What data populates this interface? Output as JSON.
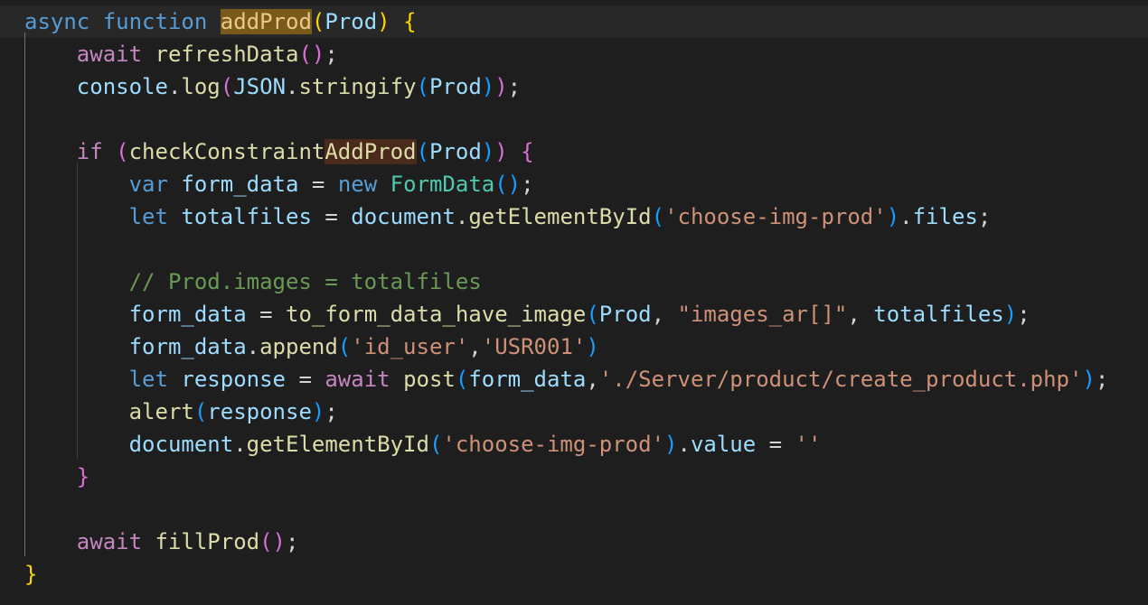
{
  "editor": {
    "lines": [
      [
        {
          "t": "async",
          "c": "kw"
        },
        {
          "t": " ",
          "c": "p"
        },
        {
          "t": "function",
          "c": "kw"
        },
        {
          "t": " ",
          "c": "p"
        },
        {
          "t": "addProd",
          "c": "fn",
          "hl": "sel"
        },
        {
          "t": "(",
          "c": "b1"
        },
        {
          "t": "Prod",
          "c": "var"
        },
        {
          "t": ")",
          "c": "b1"
        },
        {
          "t": " ",
          "c": "p"
        },
        {
          "t": "{",
          "c": "b1"
        }
      ],
      [
        {
          "t": "    ",
          "c": "p"
        },
        {
          "t": "await",
          "c": "ctl"
        },
        {
          "t": " ",
          "c": "p"
        },
        {
          "t": "refreshData",
          "c": "fn"
        },
        {
          "t": "(",
          "c": "b2"
        },
        {
          "t": ")",
          "c": "b2"
        },
        {
          "t": ";",
          "c": "p"
        }
      ],
      [
        {
          "t": "    ",
          "c": "p"
        },
        {
          "t": "console",
          "c": "var"
        },
        {
          "t": ".",
          "c": "p"
        },
        {
          "t": "log",
          "c": "fn"
        },
        {
          "t": "(",
          "c": "b2"
        },
        {
          "t": "JSON",
          "c": "var"
        },
        {
          "t": ".",
          "c": "p"
        },
        {
          "t": "stringify",
          "c": "fn"
        },
        {
          "t": "(",
          "c": "b3"
        },
        {
          "t": "Prod",
          "c": "var"
        },
        {
          "t": ")",
          "c": "b3"
        },
        {
          "t": ")",
          "c": "b2"
        },
        {
          "t": ";",
          "c": "p"
        }
      ],
      [],
      [
        {
          "t": "    ",
          "c": "p"
        },
        {
          "t": "if",
          "c": "ctl"
        },
        {
          "t": " ",
          "c": "p"
        },
        {
          "t": "(",
          "c": "b2"
        },
        {
          "t": "checkConstraint",
          "c": "fn"
        },
        {
          "t": "AddProd",
          "c": "fn",
          "hl": "match"
        },
        {
          "t": "(",
          "c": "b3"
        },
        {
          "t": "Prod",
          "c": "var"
        },
        {
          "t": ")",
          "c": "b3"
        },
        {
          "t": ")",
          "c": "b2"
        },
        {
          "t": " ",
          "c": "p"
        },
        {
          "t": "{",
          "c": "b2"
        }
      ],
      [
        {
          "t": "        ",
          "c": "p"
        },
        {
          "t": "var",
          "c": "kw"
        },
        {
          "t": " ",
          "c": "p"
        },
        {
          "t": "form_data",
          "c": "var"
        },
        {
          "t": " = ",
          "c": "p"
        },
        {
          "t": "new",
          "c": "kw"
        },
        {
          "t": " ",
          "c": "p"
        },
        {
          "t": "FormData",
          "c": "cls"
        },
        {
          "t": "(",
          "c": "b3"
        },
        {
          "t": ")",
          "c": "b3"
        },
        {
          "t": ";",
          "c": "p"
        }
      ],
      [
        {
          "t": "        ",
          "c": "p"
        },
        {
          "t": "let",
          "c": "kw"
        },
        {
          "t": " ",
          "c": "p"
        },
        {
          "t": "totalfiles",
          "c": "var"
        },
        {
          "t": " = ",
          "c": "p"
        },
        {
          "t": "document",
          "c": "var"
        },
        {
          "t": ".",
          "c": "p"
        },
        {
          "t": "getElementById",
          "c": "fn"
        },
        {
          "t": "(",
          "c": "b3"
        },
        {
          "t": "'choose-img-prod'",
          "c": "str"
        },
        {
          "t": ")",
          "c": "b3"
        },
        {
          "t": ".",
          "c": "p"
        },
        {
          "t": "files",
          "c": "var"
        },
        {
          "t": ";",
          "c": "p"
        }
      ],
      [],
      [
        {
          "t": "        ",
          "c": "p"
        },
        {
          "t": "// Prod.images = totalfiles",
          "c": "cmt"
        }
      ],
      [
        {
          "t": "        ",
          "c": "p"
        },
        {
          "t": "form_data",
          "c": "var"
        },
        {
          "t": " = ",
          "c": "p"
        },
        {
          "t": "to_form_data_have_image",
          "c": "fn"
        },
        {
          "t": "(",
          "c": "b3"
        },
        {
          "t": "Prod",
          "c": "var"
        },
        {
          "t": ", ",
          "c": "p"
        },
        {
          "t": "\"images_ar[]\"",
          "c": "str"
        },
        {
          "t": ", ",
          "c": "p"
        },
        {
          "t": "totalfiles",
          "c": "var"
        },
        {
          "t": ")",
          "c": "b3"
        },
        {
          "t": ";",
          "c": "p"
        }
      ],
      [
        {
          "t": "        ",
          "c": "p"
        },
        {
          "t": "form_data",
          "c": "var"
        },
        {
          "t": ".",
          "c": "p"
        },
        {
          "t": "append",
          "c": "fn"
        },
        {
          "t": "(",
          "c": "b3"
        },
        {
          "t": "'id_user'",
          "c": "str"
        },
        {
          "t": ",",
          "c": "p"
        },
        {
          "t": "'USR001'",
          "c": "str"
        },
        {
          "t": ")",
          "c": "b3"
        }
      ],
      [
        {
          "t": "        ",
          "c": "p"
        },
        {
          "t": "let",
          "c": "kw"
        },
        {
          "t": " ",
          "c": "p"
        },
        {
          "t": "response",
          "c": "var"
        },
        {
          "t": " = ",
          "c": "p"
        },
        {
          "t": "await",
          "c": "ctl"
        },
        {
          "t": " ",
          "c": "p"
        },
        {
          "t": "post",
          "c": "fn"
        },
        {
          "t": "(",
          "c": "b3"
        },
        {
          "t": "form_data",
          "c": "var"
        },
        {
          "t": ",",
          "c": "p"
        },
        {
          "t": "'./Server/product/create_product.php'",
          "c": "str"
        },
        {
          "t": ")",
          "c": "b3"
        },
        {
          "t": ";",
          "c": "p"
        }
      ],
      [
        {
          "t": "        ",
          "c": "p"
        },
        {
          "t": "alert",
          "c": "fn"
        },
        {
          "t": "(",
          "c": "b3"
        },
        {
          "t": "response",
          "c": "var"
        },
        {
          "t": ")",
          "c": "b3"
        },
        {
          "t": ";",
          "c": "p"
        }
      ],
      [
        {
          "t": "        ",
          "c": "p"
        },
        {
          "t": "document",
          "c": "var"
        },
        {
          "t": ".",
          "c": "p"
        },
        {
          "t": "getElementById",
          "c": "fn"
        },
        {
          "t": "(",
          "c": "b3"
        },
        {
          "t": "'choose-img-prod'",
          "c": "str"
        },
        {
          "t": ")",
          "c": "b3"
        },
        {
          "t": ".",
          "c": "p"
        },
        {
          "t": "value",
          "c": "var"
        },
        {
          "t": " = ",
          "c": "p"
        },
        {
          "t": "''",
          "c": "str"
        }
      ],
      [
        {
          "t": "    ",
          "c": "p"
        },
        {
          "t": "}",
          "c": "b2"
        }
      ],
      [],
      [
        {
          "t": "    ",
          "c": "p"
        },
        {
          "t": "await",
          "c": "ctl"
        },
        {
          "t": " ",
          "c": "p"
        },
        {
          "t": "fillProd",
          "c": "fn"
        },
        {
          "t": "(",
          "c": "b2"
        },
        {
          "t": ")",
          "c": "b2"
        },
        {
          "t": ";",
          "c": "p"
        }
      ],
      [
        {
          "t": "}",
          "c": "b1"
        }
      ]
    ]
  },
  "theme": {
    "background": "#1e1e1e",
    "current_line": "#282828",
    "keyword": "#569cd6",
    "control": "#c586c0",
    "function": "#dcdcaa",
    "variable": "#9cdcfe",
    "string": "#ce9178",
    "comment": "#6a9955",
    "class": "#4ec9b0",
    "bracket_1": "#ffd700",
    "bracket_2": "#da70d6",
    "bracket_3": "#179fff",
    "selection_highlight": "#7a5a1a",
    "match_highlight": "#4a2a1a"
  }
}
